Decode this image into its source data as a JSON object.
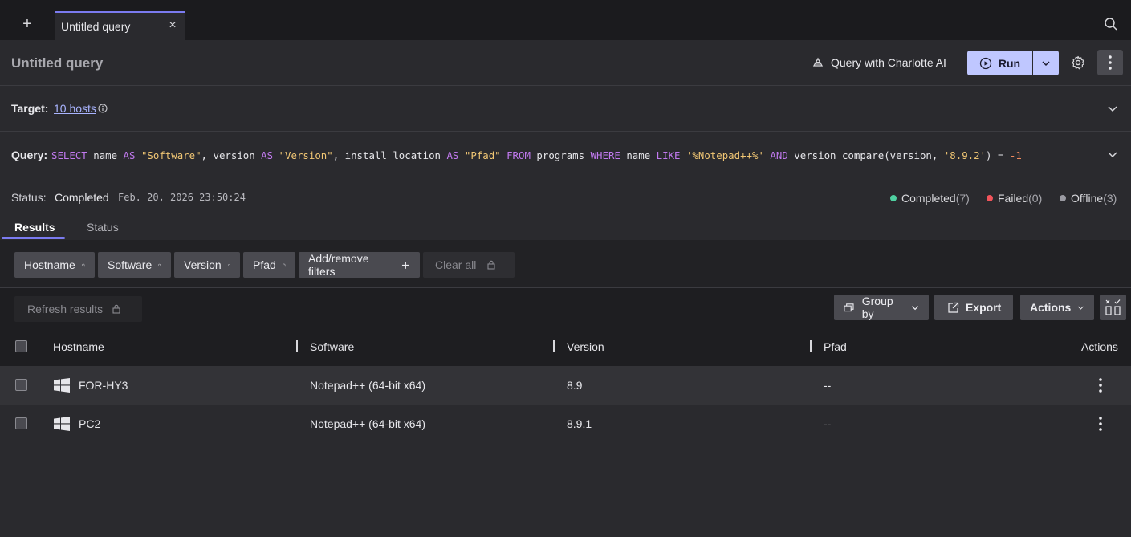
{
  "tabbar": {
    "add_label": "+",
    "tab_title": "Untitled query",
    "close_label": "×"
  },
  "header": {
    "title": "Untitled query",
    "charlotte_label": "Query with Charlotte AI",
    "run_label": "Run"
  },
  "target": {
    "label": "Target:",
    "value": "10 hosts"
  },
  "query": {
    "label": "Query:",
    "sql": "SELECT name AS \"Software\", version AS \"Version\", install_location AS \"Pfad\" FROM programs WHERE name LIKE '%Notepad++%' AND version_compare(version, '8.9.2') = -1"
  },
  "status": {
    "label": "Status:",
    "value": "Completed",
    "timestamp": "Feb. 20, 2026 23:50:24",
    "legend": [
      {
        "label": "Completed",
        "count": "(7)",
        "color": "#4fd1a1"
      },
      {
        "label": "Failed",
        "count": "(0)",
        "color": "#f2545b"
      },
      {
        "label": "Offline",
        "count": "(3)",
        "color": "#9a9aa2"
      }
    ]
  },
  "tabs": [
    {
      "label": "Results"
    },
    {
      "label": "Status"
    }
  ],
  "filters": {
    "chips": [
      "Hostname",
      "Software",
      "Version",
      "Pfad"
    ],
    "add_remove_label": "Add/remove filters",
    "clear_label": "Clear all"
  },
  "toolbar": {
    "refresh_label": "Refresh results",
    "group_by_label": "Group by",
    "export_label": "Export",
    "actions_label": "Actions"
  },
  "table": {
    "columns": [
      "Hostname",
      "Software",
      "Version",
      "Pfad",
      "Actions"
    ],
    "rows": [
      {
        "hostname": "FOR-HY3",
        "software": "Notepad++ (64-bit x64)",
        "version": "8.9",
        "pfad": "--"
      },
      {
        "hostname": "PC2",
        "software": "Notepad++ (64-bit x64)",
        "version": "8.9.1",
        "pfad": "--"
      }
    ]
  },
  "colors": {
    "accent": "#7b7bf0",
    "run_button": "#bfc7ff",
    "link": "#a9b4ff"
  },
  "icons": [
    "plus-icon",
    "close-icon",
    "search-icon",
    "charlotte-icon",
    "play-icon",
    "chevron-down-icon",
    "gear-icon",
    "kebab-icon",
    "info-icon",
    "lock-icon",
    "group-icon",
    "export-icon",
    "column-toggle-icon",
    "windows-icon"
  ]
}
